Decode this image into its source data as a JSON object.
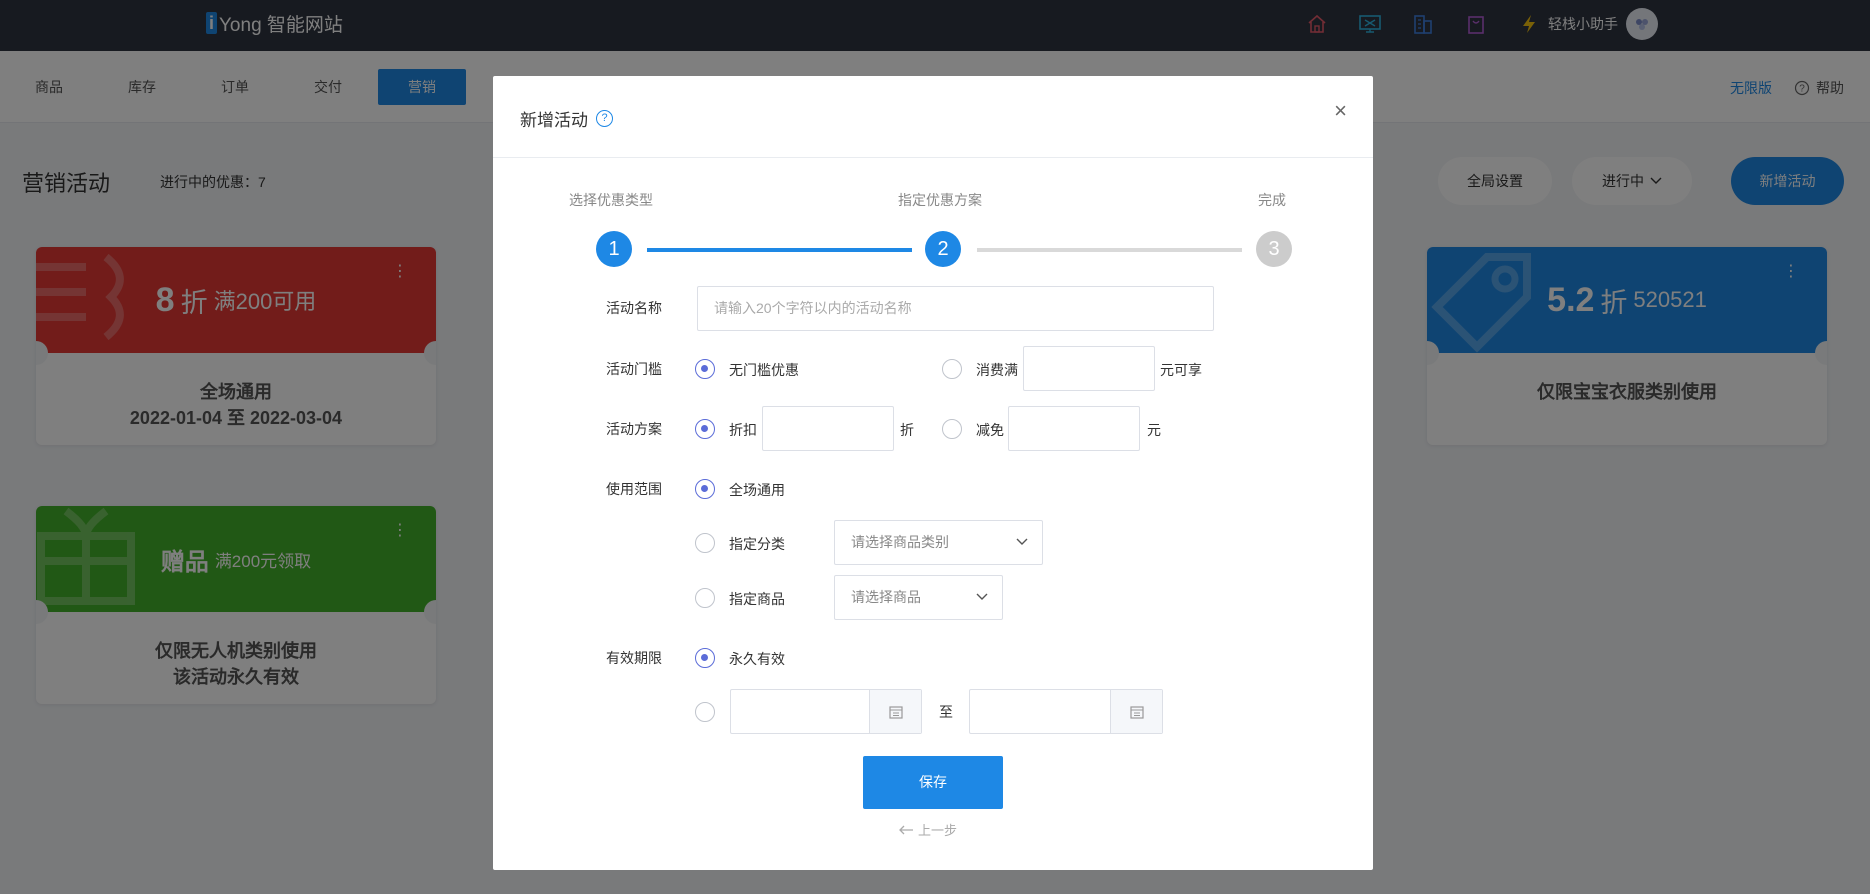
{
  "topbar": {
    "logo_letter": "i",
    "logo_text": "Yong 智能网站",
    "icons": [
      "home-icon",
      "monitor-icon",
      "building-icon",
      "bag-icon",
      "lightning-icon"
    ],
    "username": "轻栈小助手"
  },
  "nav": {
    "items": [
      "商品",
      "库存",
      "订单",
      "交付",
      "营销"
    ],
    "active": "营销",
    "plan": "无限版",
    "help": "帮助"
  },
  "page": {
    "title": "营销活动",
    "ongoing_label": "进行中的优惠：7",
    "global_settings": "全局设置",
    "status_filter": "进行中",
    "new_activity": "新增活动"
  },
  "cards": [
    {
      "big": "8",
      "unit": "折",
      "cond": "满200可用",
      "line1": "全场通用",
      "line2": "2022-01-04 至 2022-03-04",
      "color": "#e53935"
    },
    {
      "big": "赠品",
      "unit": "",
      "cond": "满200元领取",
      "line1": "仅限无人机类别使用",
      "line2": "该活动永久有效",
      "color": "#43b02a"
    },
    {
      "big": "5.2",
      "unit": "折",
      "cond": "520521",
      "line1": "仅限宝宝衣服类别使用",
      "line2": "",
      "color": "#1e88e5"
    }
  ],
  "modal": {
    "title": "新增活动",
    "help_glyph": "?",
    "close_glyph": "×",
    "steps": [
      {
        "label": "选择优惠类型",
        "num": "1"
      },
      {
        "label": "指定优惠方案",
        "num": "2"
      },
      {
        "label": "完成",
        "num": "3"
      }
    ],
    "name_label": "活动名称",
    "name_placeholder": "请输入20个字符以内的活动名称",
    "threshold_label": "活动门槛",
    "threshold_none": "无门槛优惠",
    "threshold_spend": "消费满",
    "threshold_suffix": "元可享",
    "plan_label": "活动方案",
    "plan_discount": "折扣",
    "plan_discount_unit": "折",
    "plan_reduce": "减免",
    "plan_reduce_unit": "元",
    "scope_label": "使用范围",
    "scope_all": "全场通用",
    "scope_category": "指定分类",
    "scope_category_placeholder": "请选择商品类别",
    "scope_product": "指定商品",
    "scope_product_placeholder": "请选择商品",
    "validity_label": "有效期限",
    "validity_forever": "永久有效",
    "date_to": "至",
    "save": "保存",
    "prev": "上一步"
  },
  "colors": {
    "primary": "#1e88e5",
    "topbar": "#2f3441",
    "radio_on": "#5b6cd8",
    "step_inactive": "#cccccc"
  }
}
